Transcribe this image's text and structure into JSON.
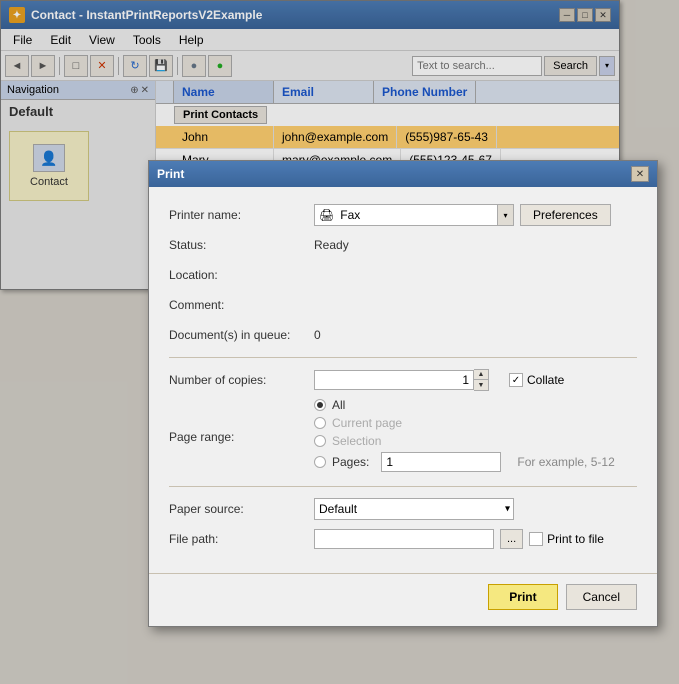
{
  "bgWindow": {
    "title": "Contact - InstantPrintReportsV2Example",
    "menuItems": [
      "File",
      "Edit",
      "View",
      "Tools",
      "Help"
    ]
  },
  "toolbar": {
    "searchPlaceholder": "Text to search...",
    "searchBtn": "Search"
  },
  "nav": {
    "title": "Navigation",
    "default": "Default",
    "item": "Contact"
  },
  "table": {
    "columns": [
      "Name",
      "Email",
      "Phone Number"
    ],
    "actionBtn": "Print Contacts",
    "rows": [
      {
        "name": "John",
        "email": "john@example.com",
        "phone": "(555)987-65-43",
        "selected": true
      },
      {
        "name": "Mary",
        "email": "mary@example.com",
        "phone": "(555)123-45-67",
        "selected": false
      }
    ]
  },
  "dialog": {
    "title": "Print",
    "printerLabel": "Printer name:",
    "printerName": "Fax",
    "preferencesBtn": "Preferences",
    "statusLabel": "Status:",
    "statusValue": "Ready",
    "locationLabel": "Location:",
    "commentLabel": "Comment:",
    "documentsLabel": "Document(s) in queue:",
    "documentsValue": "0",
    "copiesLabel": "Number of copies:",
    "copiesValue": "1",
    "collateLabel": "Collate",
    "pageRangeLabel": "Page range:",
    "radioAll": "All",
    "radioCurrentPage": "Current page",
    "radioSelection": "Selection",
    "radioPages": "Pages:",
    "pagesValue": "1",
    "pagesHint": "For example, 5-12",
    "paperSourceLabel": "Paper source:",
    "paperSourceValue": "Default",
    "filePathLabel": "File path:",
    "browseBtn": "...",
    "printToFileLabel": "Print to file",
    "printBtn": "Print",
    "cancelBtn": "Cancel"
  }
}
